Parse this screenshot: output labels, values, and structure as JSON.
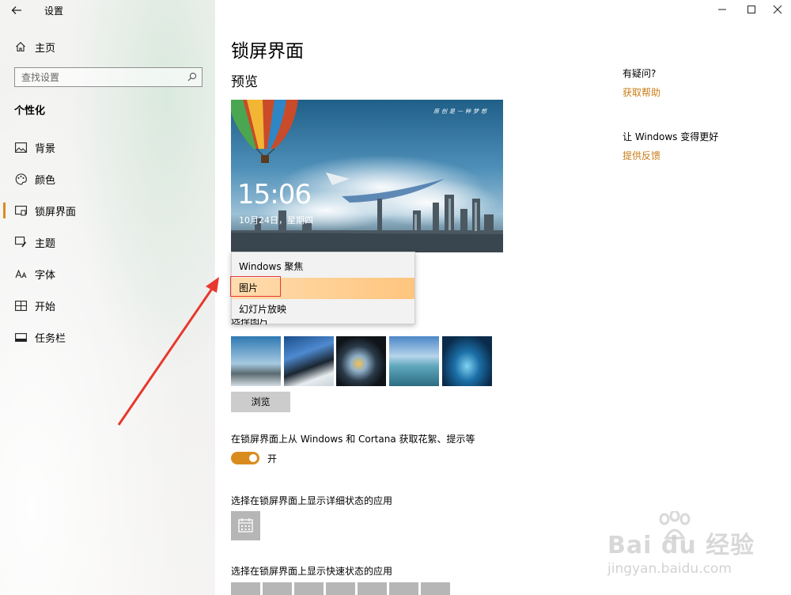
{
  "window": {
    "title": "设置",
    "back_icon": "arrow-left-icon",
    "controls": [
      "minimize",
      "maximize",
      "close"
    ]
  },
  "sidebar": {
    "home_label": "主页",
    "search_placeholder": "查找设置",
    "section_title": "个性化",
    "items": [
      {
        "label": "背景",
        "icon": "picture-icon"
      },
      {
        "label": "颜色",
        "icon": "palette-icon"
      },
      {
        "label": "锁屏界面",
        "icon": "lockscreen-icon",
        "active": true
      },
      {
        "label": "主题",
        "icon": "theme-icon"
      },
      {
        "label": "字体",
        "icon": "font-icon"
      },
      {
        "label": "开始",
        "icon": "start-icon"
      },
      {
        "label": "任务栏",
        "icon": "taskbar-icon"
      }
    ]
  },
  "main": {
    "title": "锁屏界面",
    "preview_heading": "预览",
    "preview": {
      "time": "15:06",
      "date": "10月24日，星期四",
      "poem": "原创是一种梦想"
    },
    "background_dropdown": {
      "options": [
        "Windows 聚焦",
        "图片",
        "幻灯片放映"
      ],
      "selected": "图片"
    },
    "choose_picture_label": "选择图片",
    "browse_button": "浏览",
    "fun_facts_label": "在锁屏界面上从 Windows 和 Cortana 获取花絮、提示等",
    "toggle_state": "开",
    "detail_app_label": "选择在锁屏界面上显示详细状态的应用",
    "quick_app_label": "选择在锁屏界面上显示快速状态的应用"
  },
  "help": {
    "question_title": "有疑问?",
    "get_help_link": "获取帮助",
    "improve_title": "让 Windows 变得更好",
    "feedback_link": "提供反馈"
  },
  "watermark": {
    "brand": "Bai du 经验",
    "url": "jingyan.baidu.com"
  },
  "colors": {
    "accent": "#d98b1e",
    "link": "#c87c16",
    "highlight": "#ffc57e",
    "annotation": "#e8372d"
  }
}
